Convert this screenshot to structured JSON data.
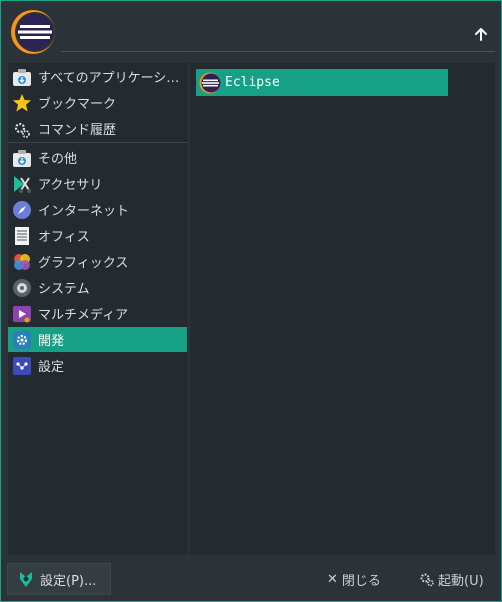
{
  "header": {
    "logo_icon": "eclipse-logo-icon",
    "up_icon": "arrow-up-icon"
  },
  "categories": [
    {
      "label": "すべてのアプリケーシ…",
      "icon": "folder-download-icon"
    },
    {
      "label": "ブックマーク",
      "icon": "star-icon"
    },
    {
      "label": "コマンド履歴",
      "icon": "gear-run-icon"
    },
    {
      "label": "その他",
      "icon": "folder-download-icon"
    },
    {
      "label": "アクセサリ",
      "icon": "accessories-icon"
    },
    {
      "label": "インターネット",
      "icon": "compass-icon"
    },
    {
      "label": "オフィス",
      "icon": "document-icon"
    },
    {
      "label": "グラフィックス",
      "icon": "palette-icon"
    },
    {
      "label": "システム",
      "icon": "system-icon"
    },
    {
      "label": "マルチメディア",
      "icon": "multimedia-icon"
    },
    {
      "label": "開発",
      "icon": "development-icon",
      "selected": true
    },
    {
      "label": "設定",
      "icon": "settings-icon"
    }
  ],
  "apps": [
    {
      "label": "Eclipse",
      "icon": "eclipse-icon",
      "selected": true
    }
  ],
  "footer": {
    "settings_label": "設定(P)...",
    "close_label": "閉じる",
    "launch_label": "起動(U)"
  },
  "colors": {
    "accent": "#16a085",
    "background": "#2b3338",
    "pane": "#232b30"
  }
}
